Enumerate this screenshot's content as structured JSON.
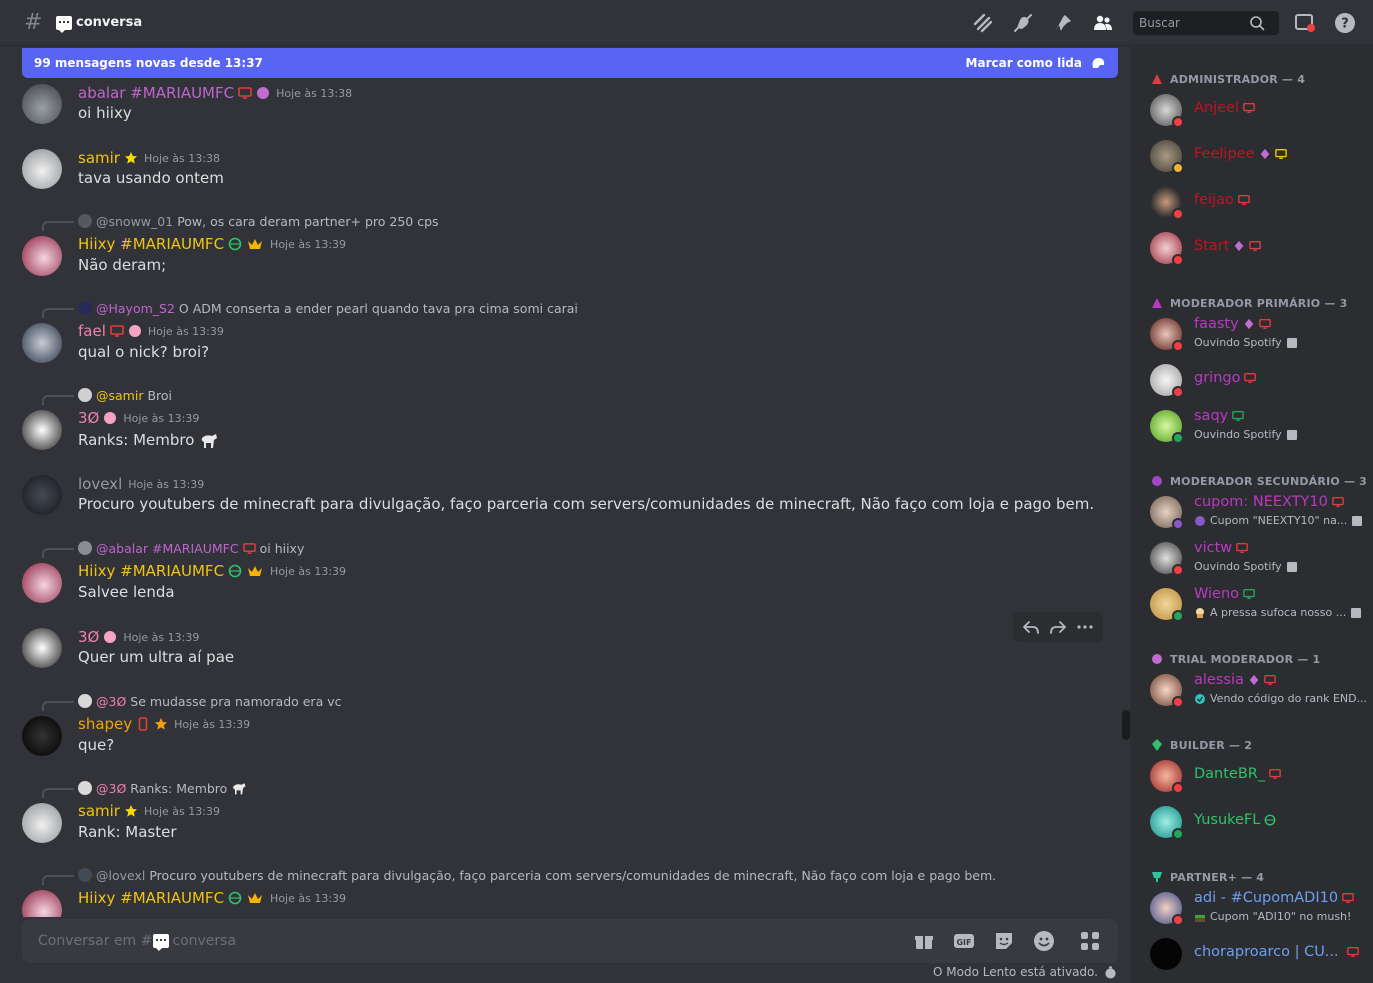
{
  "header": {
    "channel_name": "conversa",
    "search_placeholder": "Buscar"
  },
  "new_messages_bar": {
    "text": "99 mensagens novas desde 13:37",
    "action": "Marcar como lida"
  },
  "messages": [
    {
      "author": "abalar #MARIAUMFC",
      "time": "Hoje às 13:38",
      "text": "oi hiixy"
    },
    {
      "author": "samir",
      "time": "Hoje às 13:38",
      "text": "tava usando ontem"
    },
    {
      "reply_to": "@snoww_01",
      "reply_text": "Pow, os cara deram partner+ pro  250 cps",
      "author": "Hiixy #MARIAUMFC",
      "time": "Hoje às 13:39",
      "text": "Não deram;"
    },
    {
      "reply_to": "@Hayom_S2",
      "reply_text": "O ADM conserta a ender pearl quando tava pra cima somi carai",
      "author": "fael",
      "time": "Hoje às 13:39",
      "text": "qual o nick? broi?"
    },
    {
      "reply_to": "@samir",
      "reply_text": "Broi",
      "author": "3Ø",
      "time": "Hoje às 13:39",
      "text": "Ranks: Membro"
    },
    {
      "author": "lovexl",
      "time": "Hoje às 13:39",
      "text": "Procuro youtubers de minecraft para divulgação, faço parceria com servers/comunidades de minecraft, Não faço com loja e pago bem."
    },
    {
      "reply_to": "@abalar #MARIAUMFC",
      "reply_text": "oi hiixy",
      "author": "Hiixy #MARIAUMFC",
      "time": "Hoje às 13:39",
      "text": "Salvee lenda"
    },
    {
      "author": "3Ø",
      "time": "Hoje às 13:39",
      "text": "Quer um ultra aí pae"
    },
    {
      "reply_to": "@3Ø",
      "reply_text": "Se mudasse pra namorado era vc",
      "author": "shapey",
      "time": "Hoje às 13:39",
      "text": "que?"
    },
    {
      "reply_to": "@3Ø",
      "reply_text": "Ranks: Membro",
      "author": "samir",
      "time": "Hoje às 13:39",
      "text": "Rank: Master"
    },
    {
      "reply_to": "@lovexl",
      "reply_text": "Procuro youtubers de minecraft para divulgação, faço parceria com servers/comunidades de minecraft, Não faço com loja e pago bem.",
      "author": "Hiixy #MARIAUMFC",
      "time": "Hoje às 13:39",
      "text": ""
    }
  ],
  "composer": {
    "placeholder_prefix": "Conversar em #",
    "placeholder_channel": "conversa",
    "slowmode": "O Modo Lento está ativado."
  },
  "roles": [
    {
      "name": "ADMINISTRADOR — 4"
    },
    {
      "name": "MODERADOR PRIMÁRIO — 3"
    },
    {
      "name": "MODERADOR SECUNDÁRIO — 3"
    },
    {
      "name": "TRIAL MODERADOR — 1"
    },
    {
      "name": "BUILDER — 2"
    },
    {
      "name": "PARTNER+ — 4"
    }
  ],
  "members": [
    {
      "name": "Anjeel"
    },
    {
      "name": "Feelipee"
    },
    {
      "name": "feijao"
    },
    {
      "name": "Start"
    },
    {
      "name": "faasty",
      "sub": "Ouvindo Spotify"
    },
    {
      "name": "gringo"
    },
    {
      "name": "saqy",
      "sub": "Ouvindo Spotify"
    },
    {
      "name": "cupom: NEEXTY10",
      "sub": "Cupom \"NEEXTY10\" na..."
    },
    {
      "name": "victw",
      "sub": "Ouvindo Spotify"
    },
    {
      "name": "Wieno",
      "sub": "A pressa sufoca nosso ..."
    },
    {
      "name": "alessia",
      "sub": "Vendo código do rank END..."
    },
    {
      "name": "DanteBR_"
    },
    {
      "name": "YusukeFL"
    },
    {
      "name": "adi - #CupomADI10",
      "sub": "Cupom \"ADI10\" no mush!"
    },
    {
      "name": "choraproarco | CU..."
    }
  ],
  "colors": {
    "accent": "#5865f2",
    "background": "#313338",
    "sidebar": "#2b2d31",
    "dnd": "#f23f43",
    "online": "#23a55a"
  }
}
